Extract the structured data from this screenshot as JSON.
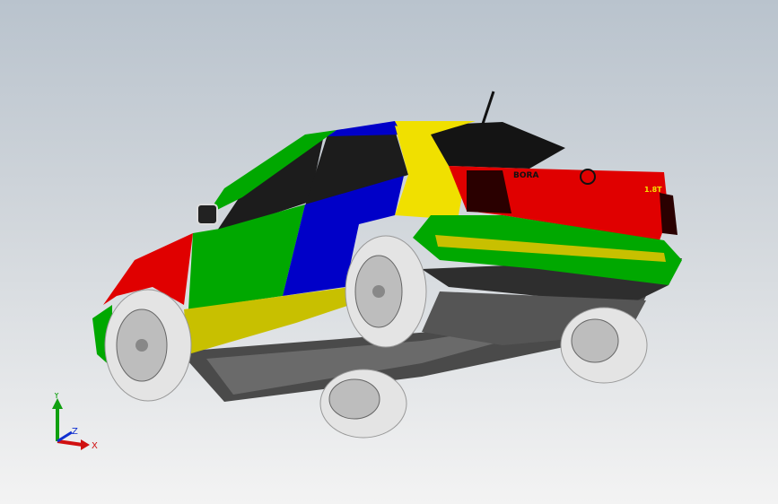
{
  "viewport": {
    "background_top": "#b9c3cd",
    "background_bottom": "#f3f3f3",
    "model": {
      "name": "sedan-3d-model",
      "face_colors": [
        "#e00000",
        "#00a800",
        "#0000c8",
        "#f0e000",
        "#1a1a1a"
      ],
      "rear_badge": "BORA",
      "trim_badge": "1.8T"
    },
    "triad": {
      "x_label": "X",
      "y_label": "Y",
      "z_label": "Z",
      "x_color": "#d01010",
      "y_color": "#10a010",
      "z_color": "#1030d0"
    }
  }
}
